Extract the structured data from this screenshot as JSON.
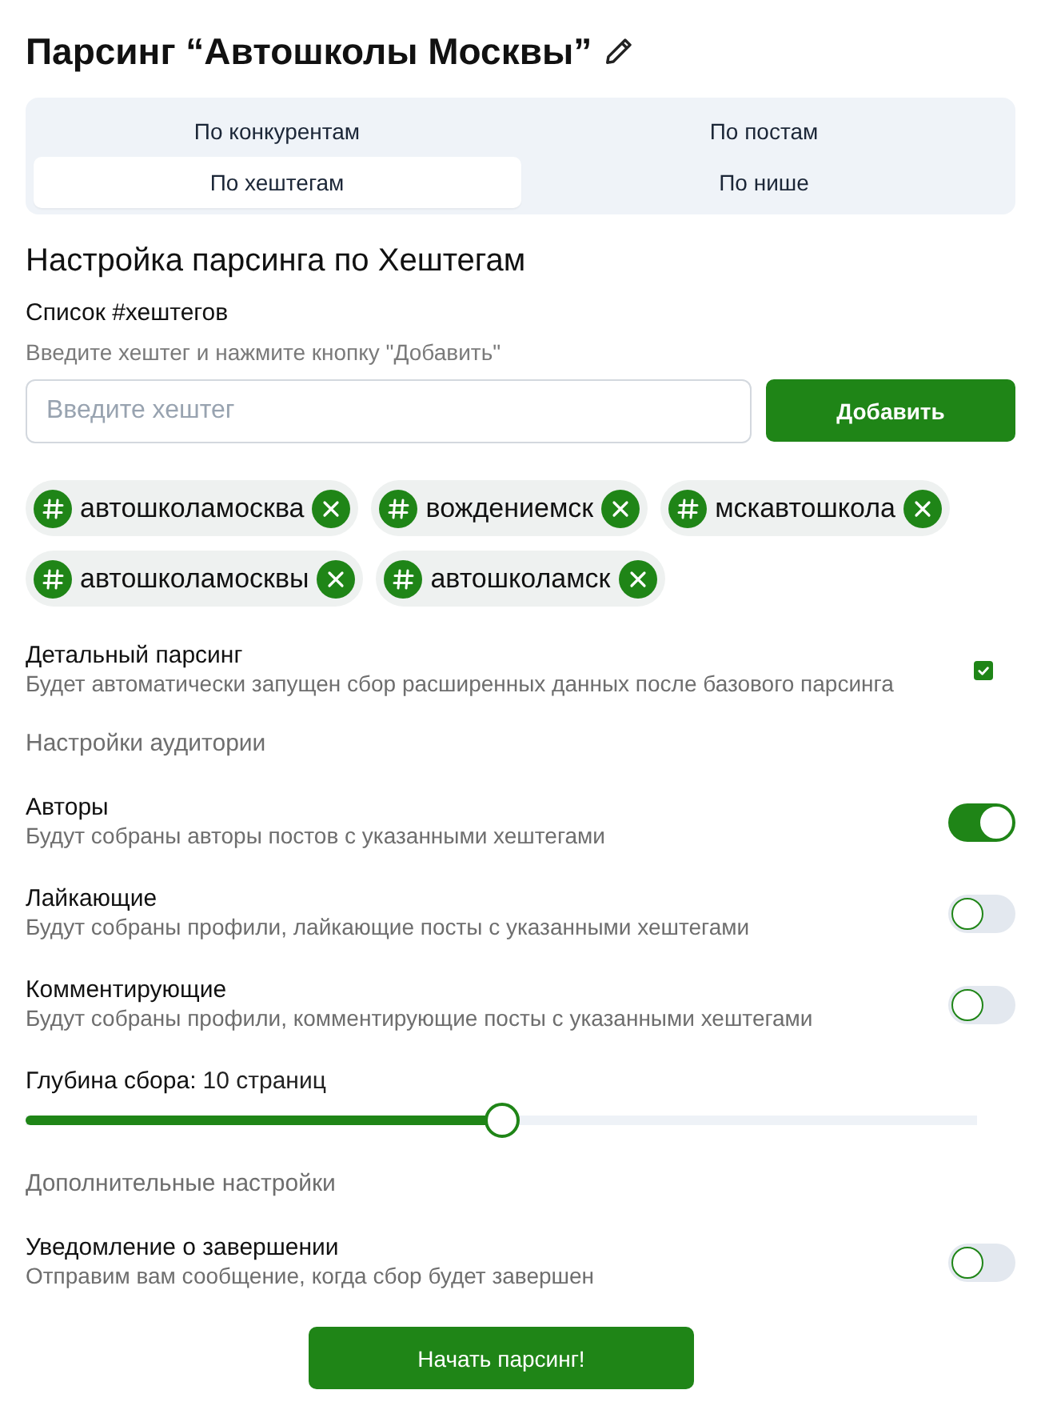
{
  "header": {
    "title": "Парсинг “Автошколы Москвы”"
  },
  "tabs": [
    {
      "label": "По конкурентам",
      "selected": false
    },
    {
      "label": "По постам",
      "selected": false
    },
    {
      "label": "По хештегам",
      "selected": true
    },
    {
      "label": "По нише",
      "selected": false
    }
  ],
  "section_title": "Настройка парсинга по Хештегам",
  "hashtags": {
    "label": "Список #хештегов",
    "hint": "Введите хештег и нажмите кнопку \"Добавить\"",
    "input": {
      "placeholder": "Введите хештег"
    },
    "add_button": "Добавить",
    "tags": [
      "автошколамосква",
      "вождениемск",
      "мскавтошкола",
      "автошколамосквы",
      "автошколамск"
    ]
  },
  "options": [
    {
      "kind": "checkbox",
      "label": "Детальный парсинг",
      "description": "Будет автоматически запущен сбор расширенных данных после базового парсинга",
      "checked": true
    },
    {
      "kind": "section",
      "label": "Настройки аудитории"
    },
    {
      "kind": "toggle",
      "label": "Авторы",
      "description": "Будут собраны авторы постов с указанными хештегами",
      "on": true
    },
    {
      "kind": "toggle",
      "label": "Лайкающие",
      "description": "Будут собраны профили, лайкающие посты с указанными хештегами",
      "on": false
    },
    {
      "kind": "toggle",
      "label": "Комментирующие",
      "description": "Будут собраны профили, комментирующие посты с указанными хештегами",
      "on": false
    },
    {
      "kind": "slider",
      "label": "Глубина сбора:",
      "value": "10 страниц",
      "level": 0.5
    },
    {
      "kind": "section",
      "label": "Дополнительные настройки"
    },
    {
      "kind": "toggle",
      "label": "Уведомление о завершении",
      "description": "Отправим вам сообщение, когда сбор будет завершен",
      "on": false
    }
  ],
  "start_button": "Начать парсинг!"
}
